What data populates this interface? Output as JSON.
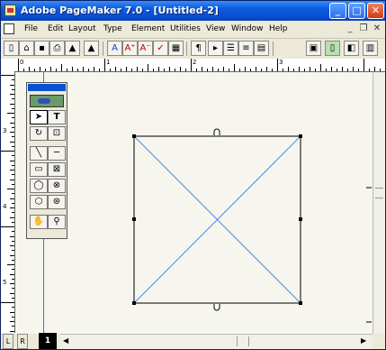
{
  "window": {
    "title": "Adobe PageMaker 7.0 - [Untitled-2]",
    "min_glyph": "_",
    "max_glyph": "□",
    "close_glyph": "✕"
  },
  "menubar": {
    "items": [
      "File",
      "Edit",
      "Layout",
      "Type",
      "Element",
      "Utilities",
      "View",
      "Window",
      "Help"
    ],
    "mdi_min": "_",
    "mdi_restore": "❐",
    "mdi_close": "✕"
  },
  "toolbar": {
    "buttons": [
      {
        "icon": "new-icon",
        "glyph": "▯"
      },
      {
        "icon": "open-icon",
        "glyph": "⌂"
      },
      {
        "icon": "save-icon",
        "glyph": "▪"
      },
      {
        "icon": "print-icon",
        "glyph": "⎙"
      },
      {
        "icon": "find-icon",
        "glyph": "▲"
      },
      {
        "icon": "font-icon",
        "glyph": "A"
      },
      {
        "icon": "font-grow-icon",
        "glyph": "A⁺"
      },
      {
        "icon": "font-shrink-icon",
        "glyph": "A⁻"
      },
      {
        "icon": "spellcheck-icon",
        "glyph": "✓"
      },
      {
        "icon": "picture-icon",
        "glyph": "▦"
      },
      {
        "icon": "paragraph-icon",
        "glyph": "¶"
      },
      {
        "icon": "indent-icon",
        "glyph": "▸"
      },
      {
        "icon": "bullets-icon",
        "glyph": "☰"
      },
      {
        "icon": "align-icon",
        "glyph": "≡"
      },
      {
        "icon": "styles-icon",
        "glyph": "▤"
      },
      {
        "icon": "frame-icon",
        "glyph": "▣"
      },
      {
        "icon": "page-icon",
        "glyph": "▯"
      },
      {
        "icon": "layers-icon",
        "glyph": "◧"
      },
      {
        "icon": "mode-icon",
        "glyph": "▥"
      }
    ]
  },
  "rulers": {
    "horizontal_labels": [
      "0",
      "1",
      "2",
      "3"
    ],
    "vertical_labels": [
      "3",
      "4",
      "5"
    ]
  },
  "toolbox": {
    "tools": [
      {
        "name": "pointer-tool",
        "glyph": "➤"
      },
      {
        "name": "text-tool",
        "glyph": "T"
      },
      {
        "name": "rotate-tool",
        "glyph": "↻"
      },
      {
        "name": "crop-tool",
        "glyph": "⊡"
      },
      {
        "name": "line-tool",
        "glyph": "╲"
      },
      {
        "name": "constrained-line-tool",
        "glyph": "─"
      },
      {
        "name": "rectangle-tool",
        "glyph": "▭"
      },
      {
        "name": "rectangle-frame-tool",
        "glyph": "⊠"
      },
      {
        "name": "ellipse-tool",
        "glyph": "◯"
      },
      {
        "name": "ellipse-frame-tool",
        "glyph": "⊗"
      },
      {
        "name": "polygon-tool",
        "glyph": "⬡"
      },
      {
        "name": "polygon-frame-tool",
        "glyph": "⊛"
      },
      {
        "name": "hand-tool",
        "glyph": "✋"
      },
      {
        "name": "zoom-tool",
        "glyph": "⚲"
      }
    ]
  },
  "page_controls": {
    "left_master": "L",
    "right_master": "R",
    "page_number": "1"
  },
  "scroll": {
    "up": "▲",
    "down": "▼",
    "left": "◀",
    "right": "▶"
  },
  "colors": {
    "title_bar": "#0a50d0",
    "frame_cross": "#4a8fe0",
    "selected_tool": "#ffffff",
    "canvas": "#f6f5ee"
  }
}
